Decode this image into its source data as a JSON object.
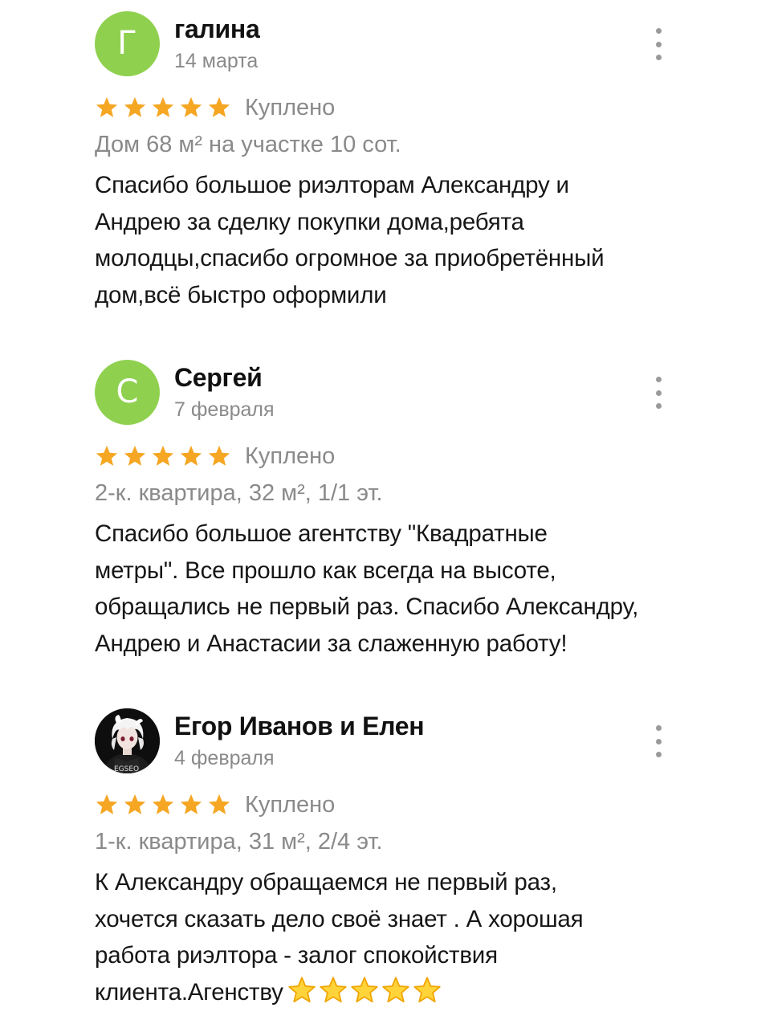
{
  "reviews": [
    {
      "avatar_letter": "Г",
      "avatar_color": "#8fd14f",
      "author": "галина",
      "date": "14 марта",
      "rating": 5,
      "badge": "Куплено",
      "object": "Дом 68 м² на участке 10 сот.",
      "text_lines": [
        "Спасибо большое риэлторам Александру и",
        "Андрею за сделку покупки дома,ребята",
        "молодцы,спасибо огромное за приобретённый",
        "дом,всё  быстро оформили"
      ]
    },
    {
      "avatar_letter": "С",
      "avatar_color": "#8fd14f",
      "author": "Сергей",
      "date": "7 февраля",
      "rating": 5,
      "badge": "Куплено",
      "object": "2-к. квартира, 32 м², 1/1 эт.",
      "text_lines": [
        "Спасибо большое агентству \"Квадратные",
        "метры\". Все прошло как всегда на высоте,",
        "обращались не первый раз. Спасибо Александру,",
        "Андрею и Анастасии за слаженную работу!"
      ]
    },
    {
      "avatar_photo": "anime-character-avatar",
      "author": "Егор Иванов и Елен",
      "date": "4 февраля",
      "rating": 5,
      "badge": "Куплено",
      "object": "1-к. квартира, 31 м², 2/4 эт.",
      "text_lines": [
        "К Александру обращаемся не первый раз,",
        "хочется сказать дело своё знает . А  хорошая",
        "работа  риэлтора - залог спокойствия",
        "клиента.Агенству"
      ],
      "trailing_emoji": "star-emoji",
      "trailing_emoji_count": 5
    }
  ],
  "colors": {
    "star": "#f5a623",
    "emoji_star_fill": "#ffd43b",
    "emoji_star_stroke": "#f0a500",
    "secondary_text": "#8a8a8a",
    "menu_dots": "#9a9a9a"
  }
}
